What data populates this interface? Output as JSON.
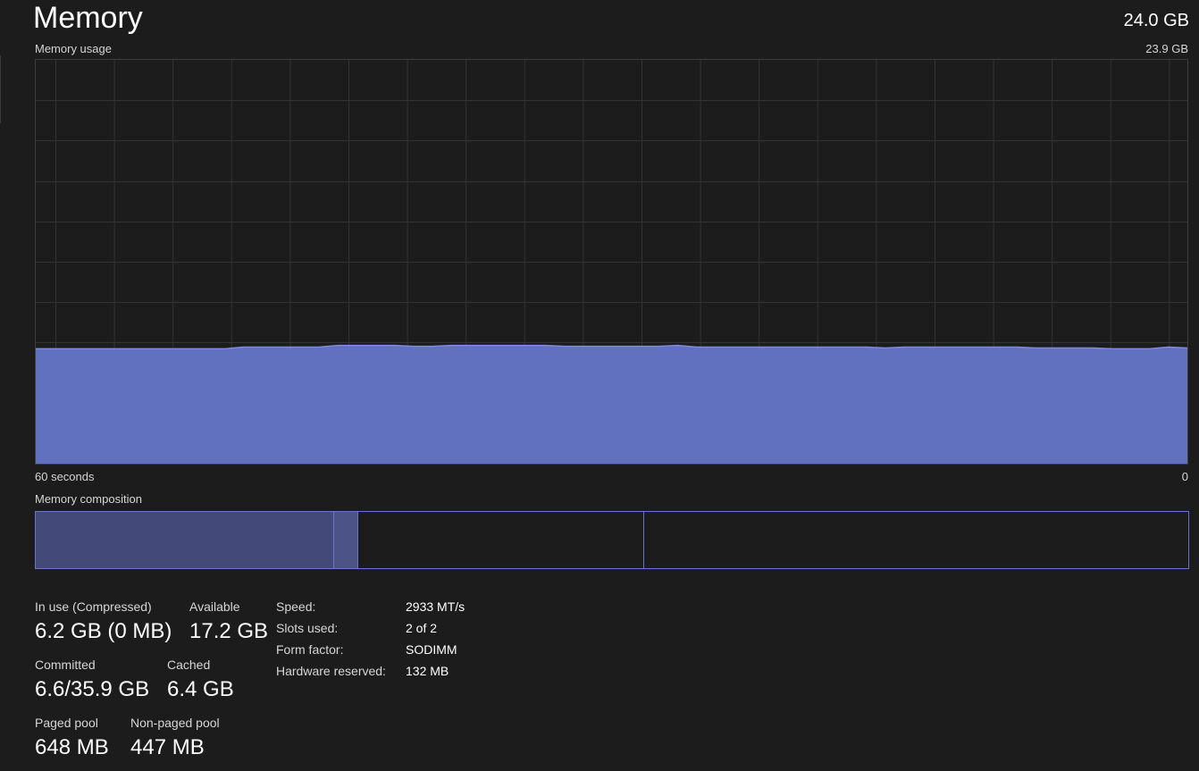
{
  "header": {
    "title": "Memory",
    "total": "24.0 GB"
  },
  "usage_graph": {
    "label": "Memory usage",
    "max_label": "23.9 GB",
    "time_left": "60 seconds",
    "time_right": "0",
    "fill_color": "#6270c0",
    "line_color": "#7f8ae0",
    "max_gb": 23.9,
    "points_gb": [
      6.8,
      6.8,
      6.8,
      6.8,
      6.8,
      6.8,
      6.8,
      6.8,
      6.8,
      6.8,
      6.8,
      6.9,
      6.9,
      6.9,
      6.9,
      6.9,
      7.0,
      7.0,
      7.0,
      7.0,
      6.95,
      6.95,
      7.0,
      7.0,
      7.0,
      7.0,
      7.0,
      7.0,
      6.95,
      6.95,
      6.95,
      6.95,
      6.95,
      6.95,
      7.0,
      6.9,
      6.9,
      6.9,
      6.9,
      6.9,
      6.9,
      6.9,
      6.9,
      6.9,
      6.9,
      6.85,
      6.9,
      6.9,
      6.9,
      6.9,
      6.9,
      6.9,
      6.9,
      6.85,
      6.85,
      6.85,
      6.85,
      6.8,
      6.8,
      6.8,
      6.9,
      6.85
    ]
  },
  "composition": {
    "label": "Memory composition"
  },
  "stats": {
    "in_use_label": "In use (Compressed)",
    "in_use_value": "6.2 GB (0 MB)",
    "available_label": "Available",
    "available_value": "17.2 GB",
    "committed_label": "Committed",
    "committed_value": "6.6/35.9 GB",
    "cached_label": "Cached",
    "cached_value": "6.4 GB",
    "paged_label": "Paged pool",
    "paged_value": "648 MB",
    "nonpaged_label": "Non-paged pool",
    "nonpaged_value": "447 MB"
  },
  "specs": {
    "speed_label": "Speed:",
    "speed_value": "2933 MT/s",
    "slots_label": "Slots used:",
    "slots_value": "2 of 2",
    "form_label": "Form factor:",
    "form_value": "SODIMM",
    "reserved_label": "Hardware reserved:",
    "reserved_value": "132 MB"
  }
}
